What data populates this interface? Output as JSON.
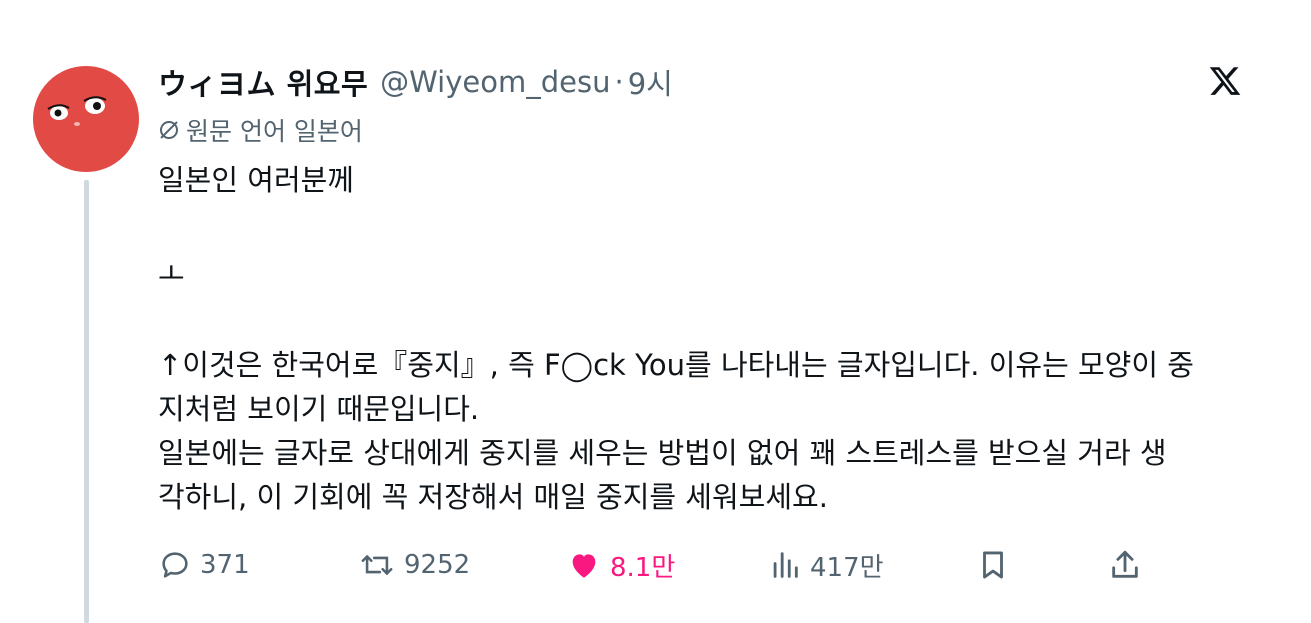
{
  "author": {
    "display_name": "ウィヨム 위요무",
    "handle": "@Wiyeom_desu",
    "separator": "·",
    "time": "9시"
  },
  "translation": {
    "label": "원문 언어 일본어"
  },
  "post": {
    "lines": [
      "일본인 여러분께",
      "ㅗ",
      "↑이것은 한국어로『중지』, 즉 F◯ck You를 나타내는 글자입니다. 이유는 모양이 중",
      "지처럼 보이기 때문입니다.",
      "일본에는 글자로 상대에게 중지를 세우는 방법이 없어 꽤 스트레스를 받으실 거라 생",
      "각하니, 이 기회에 꼭 저장해서 매일 중지를 세워보세요."
    ]
  },
  "actions": {
    "replies": "371",
    "reposts": "9252",
    "likes": "8.1만",
    "views": "417만"
  },
  "icons": {
    "reply": "reply-icon",
    "repost": "repost-icon",
    "like": "heart-icon",
    "views": "analytics-icon",
    "bookmark": "bookmark-icon",
    "share": "share-icon",
    "platform": "x-logo-icon",
    "translate": "translate-icon"
  },
  "colors": {
    "text_primary": "#0f1419",
    "text_secondary": "#536471",
    "like_pink": "#f91880",
    "avatar_red": "#e24a45",
    "thread_line": "#cfd9de"
  }
}
